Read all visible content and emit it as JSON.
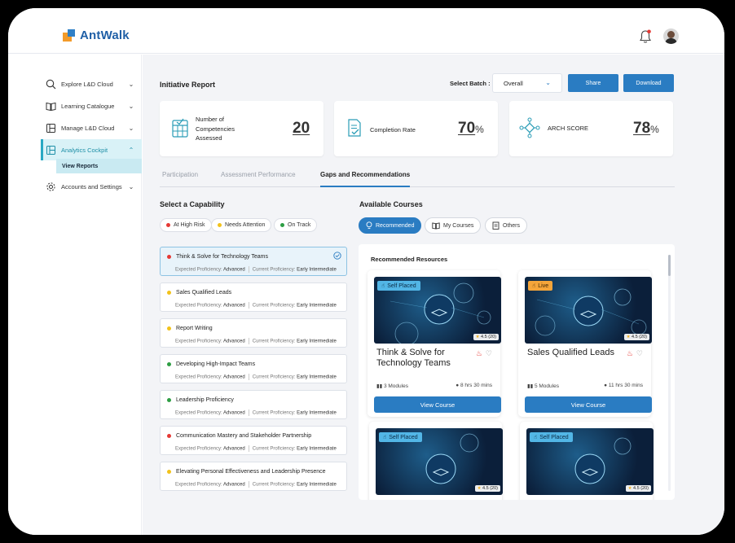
{
  "app": {
    "brand": "AntWalk"
  },
  "sidebar": {
    "items": [
      {
        "label": "Explore L&D Cloud",
        "icon": "search-icon"
      },
      {
        "label": "Learning Catalogue",
        "icon": "book-icon"
      },
      {
        "label": "Manage L&D Cloud",
        "icon": "layout-icon"
      },
      {
        "label": "Analytics Cockpit",
        "icon": "layout-icon",
        "active": true
      },
      {
        "label": "Accounts and Settings",
        "icon": "gear-icon"
      }
    ],
    "sub_item": "View Reports"
  },
  "header": {
    "title": "Initiative Report",
    "batch_label": "Select Batch :",
    "batch_value": "Overall",
    "share": "Share",
    "download": "Download"
  },
  "stats": [
    {
      "label": "Number of Competencies Assessed",
      "line1": "Number of",
      "line2": "Competencies",
      "line3": "Assessed",
      "value": "20",
      "unit": ""
    },
    {
      "label": "Completion Rate",
      "value": "70",
      "unit": "%"
    },
    {
      "label": "ARCH SCORE",
      "value": "78",
      "unit": "%"
    }
  ],
  "tabs": [
    "Participation",
    "Assessment Performance",
    "Gaps and Recommendations"
  ],
  "capability": {
    "title": "Select a Capability",
    "filters": [
      {
        "label": "At High Risk",
        "color": "#e53935"
      },
      {
        "label": "Needs Attention",
        "color": "#f2c21b"
      },
      {
        "label": "On Track",
        "color": "#2e9e44"
      }
    ],
    "expected_label": "Expected Proficiency:",
    "current_label": "Current Proficiency:",
    "items": [
      {
        "name": "Think & Solve for Technology Teams",
        "status": "#e53935",
        "expected": "Advanced",
        "current": "Early Intermediate"
      },
      {
        "name": "Sales Qualified Leads",
        "status": "#f2c21b",
        "expected": "Advanced",
        "current": "Early Intermediate"
      },
      {
        "name": "Report Writing",
        "status": "#f2c21b",
        "expected": "Advanced",
        "current": "Early Intermediate"
      },
      {
        "name": "Developing High-Impact Teams",
        "status": "#2e9e44",
        "expected": "Advanced",
        "current": "Early Intermediate"
      },
      {
        "name": "Leadership Proficiency",
        "status": "#2e9e44",
        "expected": "Advanced",
        "current": "Early Intermediate"
      },
      {
        "name": "Communication Mastery and Stakeholder Partnership",
        "status": "#e53935",
        "expected": "Advanced",
        "current": "Early Intermediate"
      },
      {
        "name": "Elevating Personal Effectiveness and Leadership Presence",
        "status": "#f2c21b",
        "expected": "Advanced",
        "current": "Early Intermediate"
      }
    ]
  },
  "courses": {
    "title": "Available Courses",
    "tabs": [
      "Recommended",
      "My Courses",
      "Others"
    ],
    "panel_title": "Recommended Resources",
    "items": [
      {
        "badge": "Self Placed",
        "rating": "4.5 (20)",
        "title": "Think & Solve for Technology Teams",
        "modules": "3 Modules",
        "duration": "8 hrs 30 mins",
        "button": "View Course"
      },
      {
        "badge": "Live",
        "rating": "4.5 (20)",
        "title": "Sales Qualified Leads",
        "modules": "5 Modules",
        "duration": "11 hrs 30 mins",
        "button": "View Course"
      },
      {
        "badge": "Self Placed",
        "rating": "4.5 (20)"
      },
      {
        "badge": "Self Placed",
        "rating": "4.5 (20)"
      }
    ]
  }
}
